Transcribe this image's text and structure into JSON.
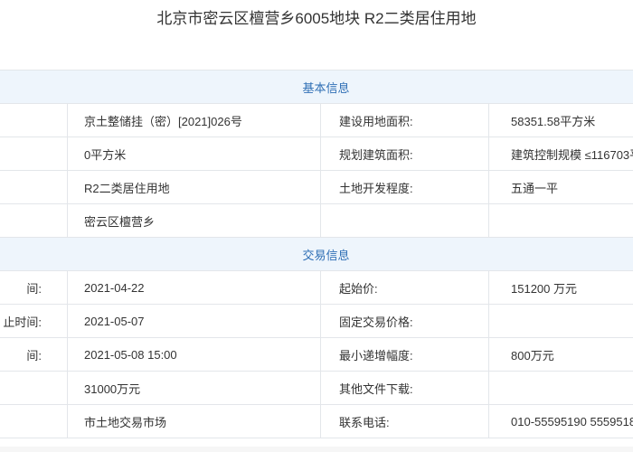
{
  "title": "北京市密云区檀营乡6005地块 R2二类居住用地",
  "basic_section": {
    "heading": "基本信息"
  },
  "basic_rows": [
    {
      "label1": "",
      "value1": "京土整储挂（密）[2021]026号",
      "label2": "建设用地面积:",
      "value2": "58351.58平方米"
    },
    {
      "label1": "",
      "value1": "0平方米",
      "label2": "规划建筑面积:",
      "value2": "建筑控制规模 ≤116703平"
    },
    {
      "label1": "",
      "value1": "R2二类居住用地",
      "label2": "土地开发程度:",
      "value2": "五通一平"
    },
    {
      "label1": "",
      "value1": "密云区檀营乡",
      "label2": "",
      "value2": ""
    }
  ],
  "trade_section": {
    "heading": "交易信息"
  },
  "trade_rows": [
    {
      "label1": "间:",
      "value1": "2021-04-22",
      "label2": "起始价:",
      "value2": "151200 万元"
    },
    {
      "label1": "止时间:",
      "value1": "2021-05-07",
      "label2": "固定交易价格:",
      "value2": ""
    },
    {
      "label1": "间:",
      "value1": "2021-05-08 15:00",
      "label2": "最小递增幅度:",
      "value2": "800万元"
    },
    {
      "label1": "",
      "value1": "31000万元",
      "label2": "其他文件下载:",
      "value2": ""
    },
    {
      "label1": "",
      "value1": "市土地交易市场",
      "label2": "联系电话:",
      "value2": "010-55595190 5559518"
    }
  ]
}
